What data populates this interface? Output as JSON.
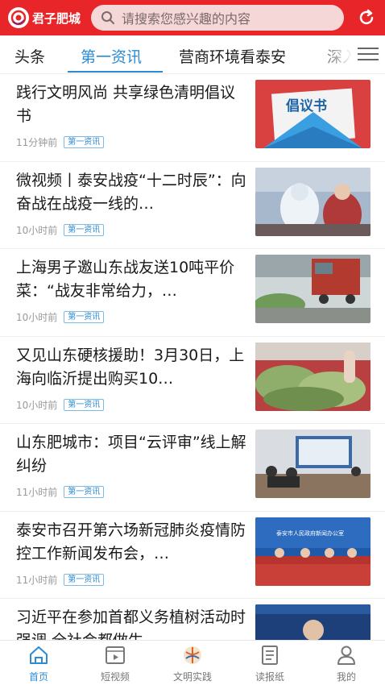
{
  "header": {
    "logo_text": "君子肥城",
    "search_placeholder": "请搜索您感兴趣的内容",
    "colors": {
      "brand": "#e8262a",
      "accent": "#2b8bd4"
    }
  },
  "tabs": [
    {
      "label": "头条",
      "active": false
    },
    {
      "label": "第一资讯",
      "active": true
    },
    {
      "label": "营商环境看泰安",
      "active": false
    },
    {
      "label": "深入",
      "active": false
    }
  ],
  "news": [
    {
      "title": "践行文明风尚 共享绿色清明倡议书",
      "time": "11分钟前",
      "tag": "第一资讯",
      "image_text": "倡议书"
    },
    {
      "title": "微视频丨泰安战疫“十二时辰”：向奋战在战疫一线的…",
      "time": "10小时前",
      "tag": "第一资讯"
    },
    {
      "title": "上海男子邀山东战友送10吨平价菜：“战友非常给力，…",
      "time": "10小时前",
      "tag": "第一资讯"
    },
    {
      "title": "又见山东硬核援助！3月30日，上海向临沂提出购买10…",
      "time": "10小时前",
      "tag": "第一资讯"
    },
    {
      "title": "山东肥城市：项目“云评审”线上解纠纷",
      "time": "11小时前",
      "tag": "第一资讯"
    },
    {
      "title": "泰安市召开第六场新冠肺炎疫情防控工作新闻发布会，…",
      "time": "11小时前",
      "tag": "第一资讯",
      "image_text": "泰安市人民政府新闻办公室"
    },
    {
      "title": "习近平在参加首都义务植树活动时强调 全社会都做生…",
      "time": "",
      "tag": ""
    }
  ],
  "bottom_nav": [
    {
      "label": "首页",
      "icon": "home-icon",
      "active": true
    },
    {
      "label": "短视频",
      "icon": "video-icon",
      "active": false
    },
    {
      "label": "文明实践",
      "icon": "civilization-icon",
      "active": false
    },
    {
      "label": "读报纸",
      "icon": "newspaper-icon",
      "active": false
    },
    {
      "label": "我的",
      "icon": "profile-icon",
      "active": false
    }
  ]
}
